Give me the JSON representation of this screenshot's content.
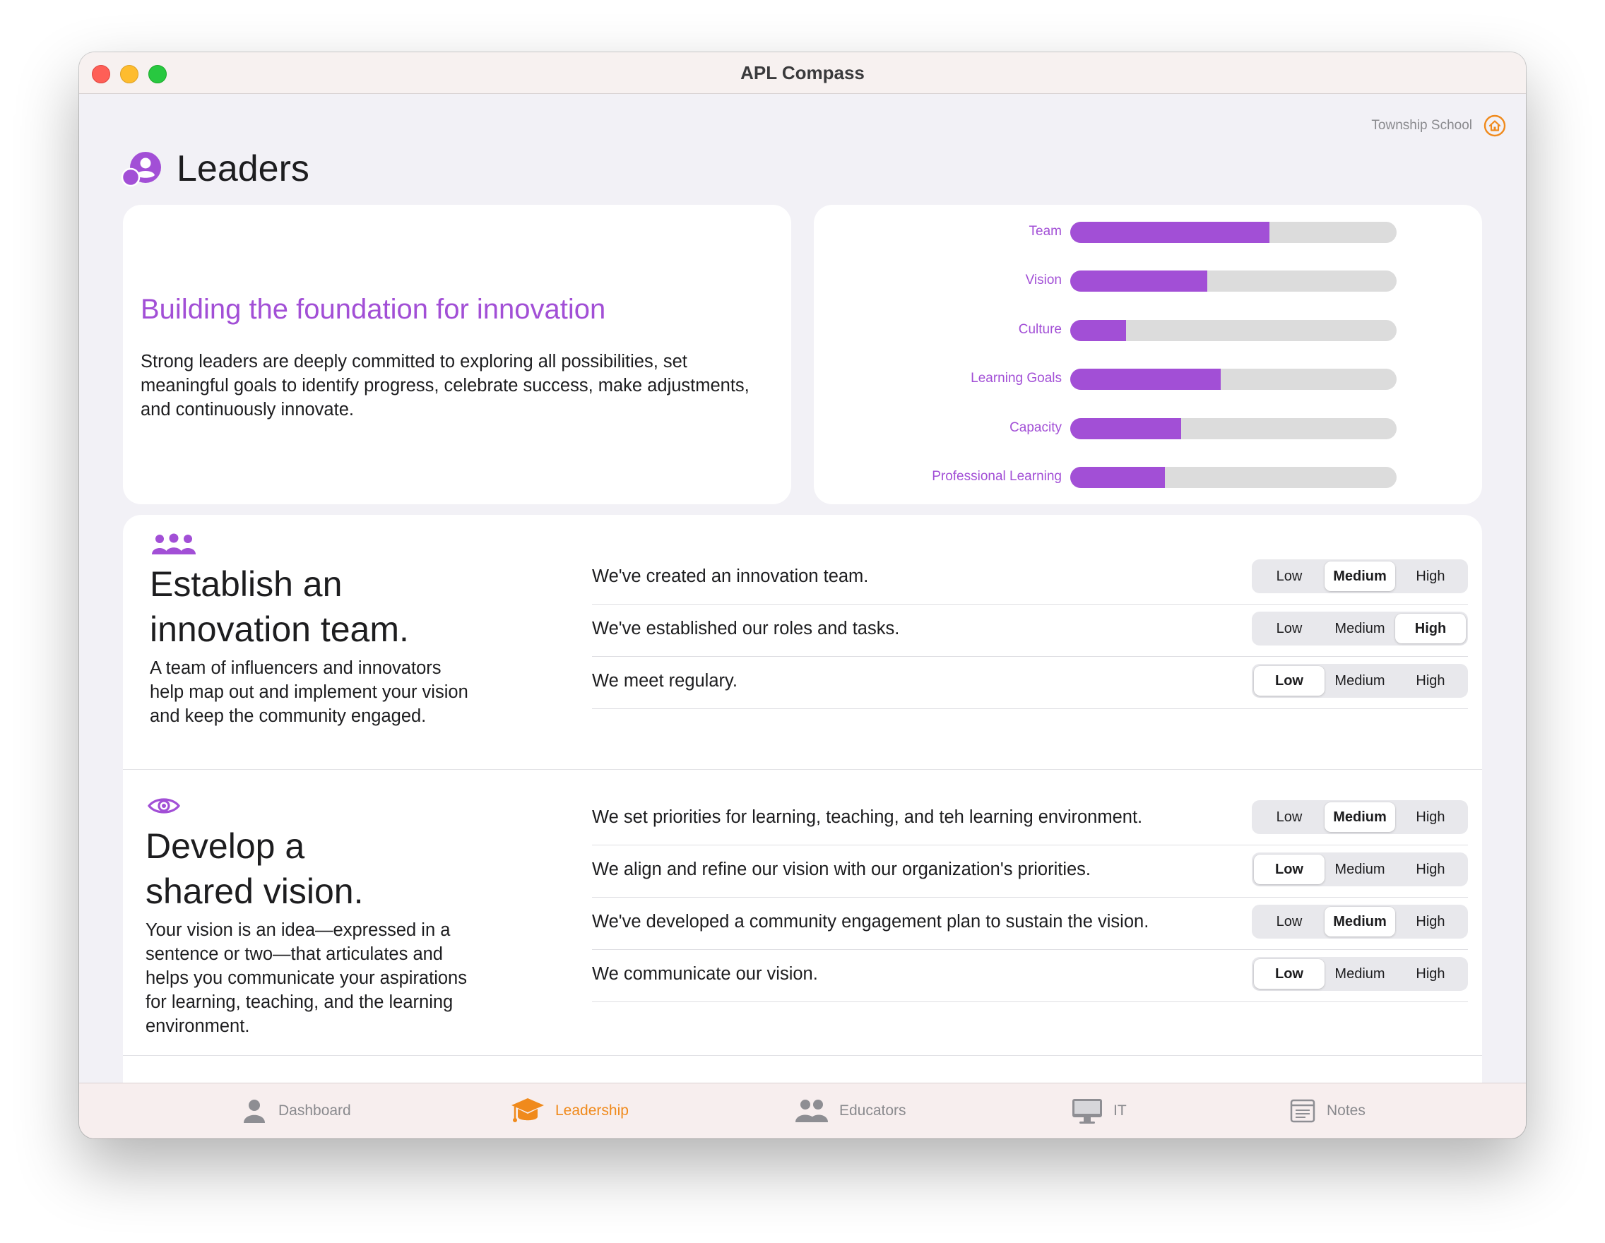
{
  "window": {
    "title": "APL Compass"
  },
  "header": {
    "school_name": "Township School",
    "page_title": "Leaders"
  },
  "intro": {
    "heading": "Building the foundation for innovation",
    "body": "Strong leaders are deeply committed to exploring all possibilities, set meaningful goals to identify progress, celebrate success, make adjustments, and continuously innovate."
  },
  "progress": {
    "items": [
      {
        "label": "Team",
        "value": 0.61
      },
      {
        "label": "Vision",
        "value": 0.42
      },
      {
        "label": "Culture",
        "value": 0.17
      },
      {
        "label": "Learning Goals",
        "value": 0.46
      },
      {
        "label": "Capacity",
        "value": 0.34
      },
      {
        "label": "Professional Learning",
        "value": 0.29
      }
    ]
  },
  "sections": [
    {
      "icon": "people-group-icon",
      "title_line1": "Establish an",
      "title_line2": "innovation team.",
      "description": "A team of influencers and innovators help map out and implement your vision and keep the community engaged.",
      "items": [
        {
          "text": "We've created an innovation team.",
          "selected": "Medium"
        },
        {
          "text": "We've established our roles and tasks.",
          "selected": "High"
        },
        {
          "text": "We meet regulary.",
          "selected": "Low"
        }
      ]
    },
    {
      "icon": "eye-icon",
      "title_line1": "Develop a",
      "title_line2": "shared vision.",
      "description": "Your vision is an idea—expressed in a sentence or two—that articulates and helps you communicate your aspirations for learning, teaching, and the learning environment.",
      "items": [
        {
          "text": "We set priorities for learning, teaching, and teh learning environment.",
          "selected": "Medium"
        },
        {
          "text": "We align and refine our vision with our organization's priorities.",
          "selected": "Low"
        },
        {
          "text": "We've developed a community engagement plan to sustain the vision.",
          "selected": "Medium"
        },
        {
          "text": "We communicate our vision.",
          "selected": "Low"
        }
      ]
    }
  ],
  "rating_options": [
    "Low",
    "Medium",
    "High"
  ],
  "tabs": [
    {
      "label": "Dashboard",
      "icon": "person-icon",
      "active": false
    },
    {
      "label": "Leadership",
      "icon": "graduation-cap-icon",
      "active": true
    },
    {
      "label": "Educators",
      "icon": "people-icon",
      "active": false
    },
    {
      "label": "IT",
      "icon": "desktop-icon",
      "active": false
    },
    {
      "label": "Notes",
      "icon": "notes-icon",
      "active": false
    }
  ],
  "colors": {
    "accent": "#a24fd6",
    "active_tab": "#f08a1c",
    "track": "#dcdcdc"
  }
}
